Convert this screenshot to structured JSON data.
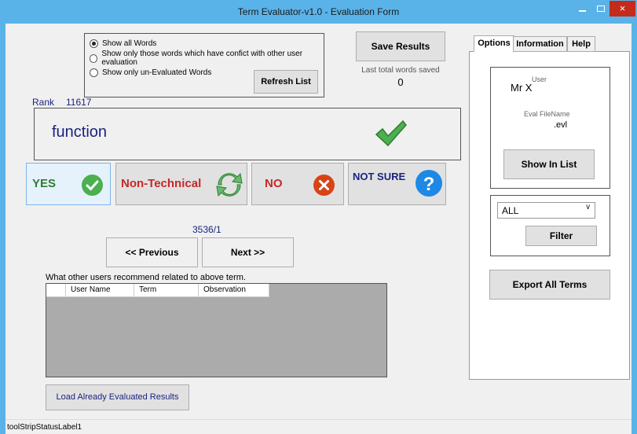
{
  "window": {
    "title": "Term Evaluator-v1.0 - Evaluation Form",
    "close_glyph": "×"
  },
  "filter_options": {
    "items": [
      "Show all Words",
      "Show only those words which have confict with other user evaluation",
      "Show only un-Evaluated Words"
    ],
    "selected_index": 0,
    "refresh_label": "Refresh List"
  },
  "save": {
    "label": "Save Results",
    "last_saved_label": "Last total words saved",
    "last_saved_count": "0"
  },
  "rank": {
    "label": "Rank",
    "value": "11617"
  },
  "term": {
    "word": "function",
    "status_icon": "check-mark-icon"
  },
  "evaluation": {
    "yes": {
      "label": "YES",
      "icon": "check-circle-icon",
      "color": "#2e7d32"
    },
    "non_technical": {
      "label": "Non-Technical",
      "icon": "refresh-arrows-icon",
      "color": "#c62828"
    },
    "no": {
      "label": "NO",
      "icon": "x-circle-icon",
      "color": "#c62828"
    },
    "not_sure": {
      "label": "NOT SURE",
      "icon": "question-circle-icon",
      "color": "#1a237e"
    }
  },
  "navigation": {
    "counter": "3536/1",
    "previous_label": "<< Previous",
    "next_label": "Next >>"
  },
  "recommendations": {
    "label": "What other users recommend related to above term.",
    "columns": [
      "",
      "User Name",
      "Term",
      "Observation"
    ],
    "rows": []
  },
  "load_label": "Load Already Evaluated Results",
  "status_bar": {
    "label": "toolStripStatusLabel1"
  },
  "right_panel": {
    "tabs": [
      "Options",
      "Information",
      "Help"
    ],
    "active_tab": "Options",
    "user_caption": "User",
    "user_name": "Mr X",
    "eval_file_caption": "Eval FileName",
    "eval_file_value": ".evl",
    "show_in_list_label": "Show In List",
    "filter_value": "ALL",
    "filter_label": "Filter",
    "export_label": "Export All Terms"
  }
}
